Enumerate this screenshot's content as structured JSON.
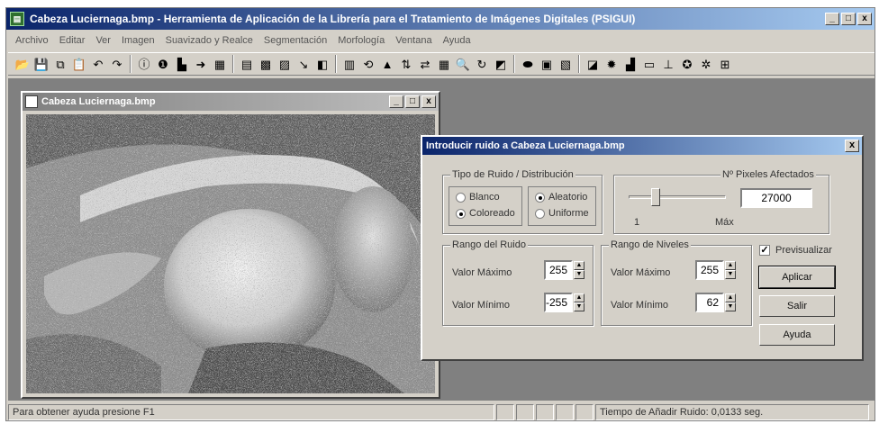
{
  "window": {
    "title": "Cabeza Luciernaga.bmp - Herramienta de Aplicación de la Librería para el Tratamiento de Imágenes Digitales (PSIGUI)",
    "icon": "app-icon",
    "minimize": "_",
    "maximize": "□",
    "close": "x"
  },
  "menu": [
    "Archivo",
    "Editar",
    "Ver",
    "Imagen",
    "Suavizado y Realce",
    "Segmentación",
    "Morfología",
    "Ventana",
    "Ayuda"
  ],
  "toolbar": {
    "groups": [
      [
        {
          "icon": "open-folder-icon",
          "glyph": "📂"
        },
        {
          "icon": "save-icon",
          "glyph": "💾"
        },
        {
          "icon": "copy-icon",
          "glyph": "⧉"
        },
        {
          "icon": "paste-icon",
          "glyph": "📋"
        },
        {
          "icon": "undo-icon",
          "glyph": "↶"
        },
        {
          "icon": "redo-icon",
          "glyph": "↷"
        }
      ],
      [
        {
          "icon": "info-icon",
          "glyph": "ⓘ"
        },
        {
          "icon": "properties-icon",
          "glyph": "❶"
        },
        {
          "icon": "histogram-icon",
          "glyph": "▙"
        },
        {
          "icon": "arrow-icon",
          "glyph": "➜"
        },
        {
          "icon": "palette-icon",
          "glyph": "▦"
        }
      ],
      [
        {
          "icon": "color-bars-icon",
          "glyph": "▤"
        },
        {
          "icon": "filter-icon",
          "glyph": "▩"
        },
        {
          "icon": "noise-icon",
          "glyph": "▨"
        },
        {
          "icon": "edge-icon",
          "glyph": "↘"
        },
        {
          "icon": "layers-icon",
          "glyph": "◧"
        }
      ],
      [
        {
          "icon": "binary-icon",
          "glyph": "▥"
        },
        {
          "icon": "rotate-icon",
          "glyph": "⟲"
        },
        {
          "icon": "shape-icon",
          "glyph": "▲"
        },
        {
          "icon": "flip-vertical-icon",
          "glyph": "⇅"
        },
        {
          "icon": "flip-horizontal-icon",
          "glyph": "⇄"
        },
        {
          "icon": "grid-icon",
          "glyph": "▦"
        },
        {
          "icon": "zoom-icon",
          "glyph": "🔍"
        },
        {
          "icon": "refresh-icon",
          "glyph": "↻"
        },
        {
          "icon": "frame-icon",
          "glyph": "◩"
        }
      ],
      [
        {
          "icon": "ellipse-icon",
          "glyph": "⬬"
        },
        {
          "icon": "window-icon",
          "glyph": "▣"
        },
        {
          "icon": "mosaic-icon",
          "glyph": "▧"
        }
      ],
      [
        {
          "icon": "crop-icon",
          "glyph": "◪"
        },
        {
          "icon": "sun-icon",
          "glyph": "✹"
        },
        {
          "icon": "bars-icon",
          "glyph": "▟"
        },
        {
          "icon": "image-icon",
          "glyph": "▭"
        },
        {
          "icon": "erode-icon",
          "glyph": "⊥"
        },
        {
          "icon": "dilate-icon",
          "glyph": "✪"
        },
        {
          "icon": "skeleton-icon",
          "glyph": "✲"
        },
        {
          "icon": "table-icon",
          "glyph": "⊞"
        }
      ]
    ]
  },
  "child_window": {
    "title": "Cabeza Luciernaga.bmp",
    "minimize": "_",
    "maximize": "□",
    "close": "x"
  },
  "dialog": {
    "title": "Introducir ruido a Cabeza Luciernaga.bmp",
    "close": "x",
    "noise_type": {
      "label": "Tipo de Ruido / Distribución",
      "options": [
        {
          "label": "Blanco",
          "selected": false
        },
        {
          "label": "Coloreado",
          "selected": true
        },
        {
          "label": "Aleatorio",
          "selected": true
        },
        {
          "label": "Uniforme",
          "selected": false
        }
      ]
    },
    "pixels": {
      "label": "Nº Pixeles Afectados",
      "value": "27000",
      "min_label": "1",
      "max_label": "Máx",
      "slider_fraction": 0.25
    },
    "noise_range": {
      "label": "Rango del Ruido",
      "max_label": "Valor Máximo",
      "max_value": "255",
      "min_label": "Valor Mínimo",
      "min_value": "-255"
    },
    "level_range": {
      "label": "Rango de Niveles",
      "max_label": "Valor Máximo",
      "max_value": "255",
      "min_label": "Valor Mínimo",
      "min_value": "62"
    },
    "preview": {
      "label": "Previsualizar",
      "checked": true
    },
    "buttons": {
      "apply": "Aplicar",
      "exit": "Salir",
      "help": "Ayuda"
    }
  },
  "status": {
    "help_text": "Para obtener ayuda presione F1",
    "time_text": "Tiempo de Añadir Ruido: 0,0133 seg."
  }
}
